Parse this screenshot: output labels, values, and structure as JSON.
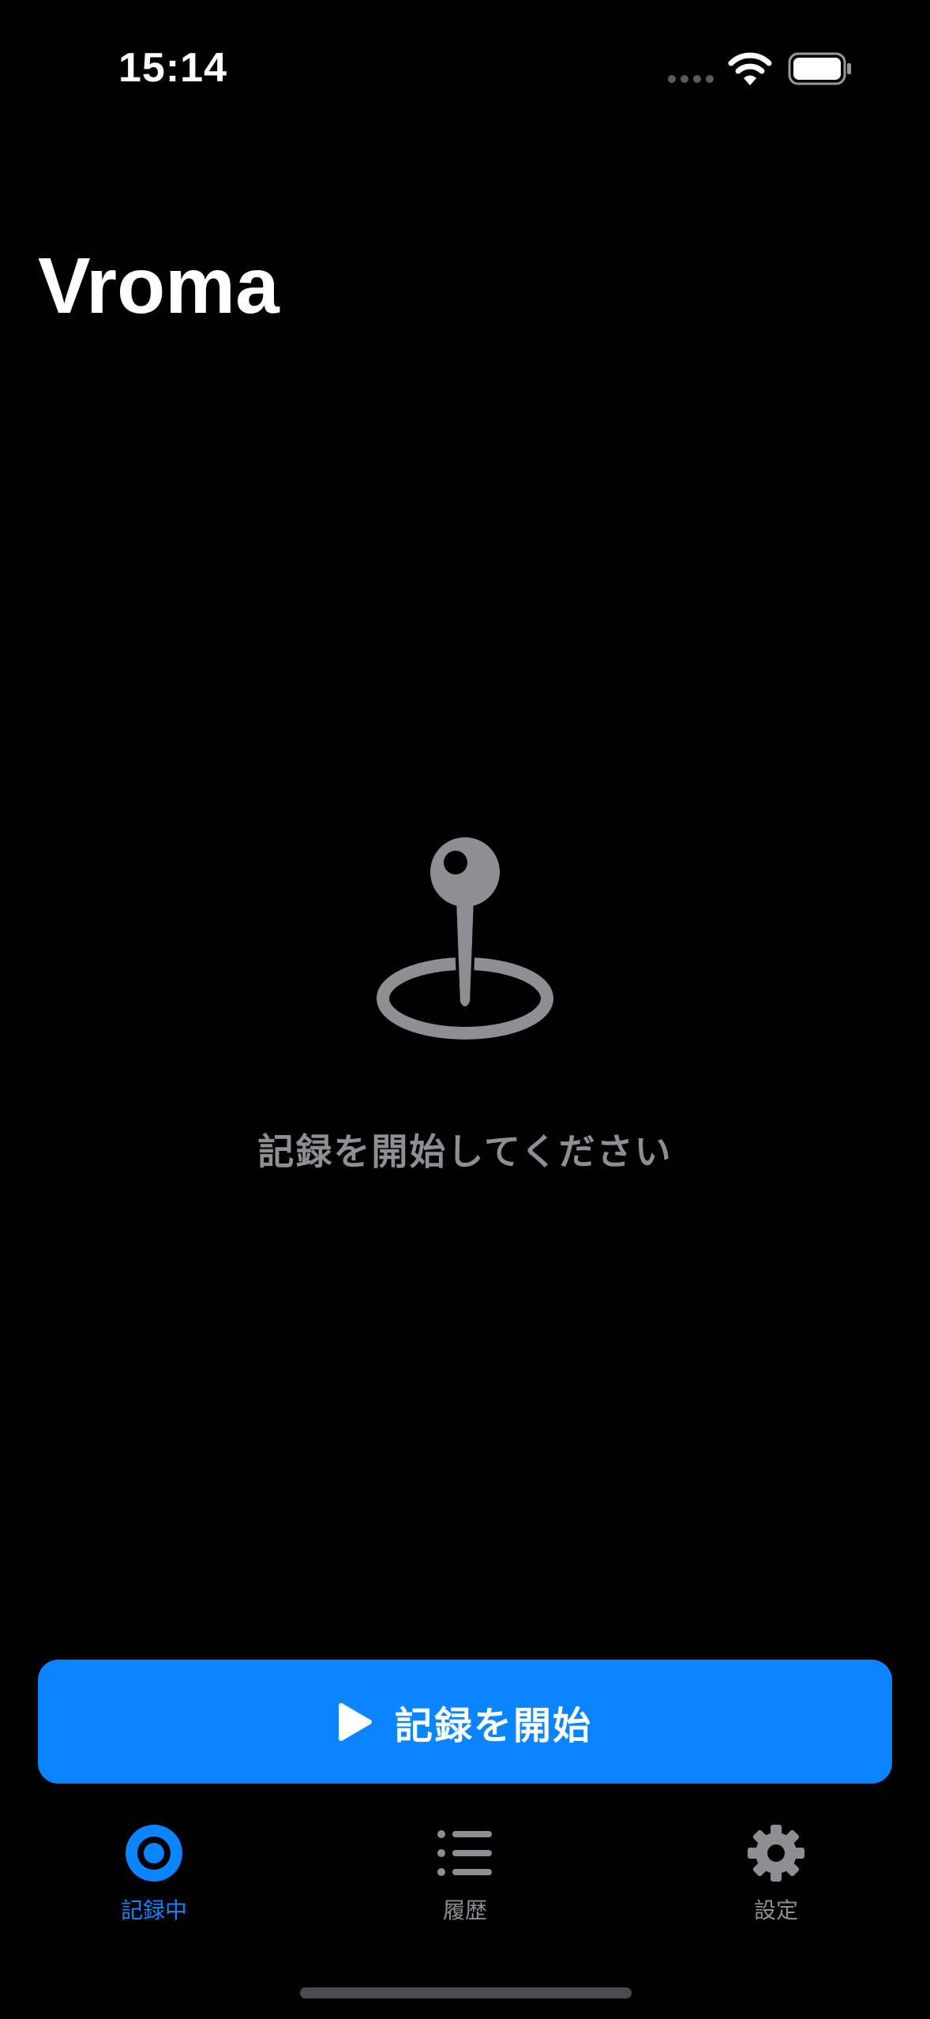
{
  "status_bar": {
    "time": "15:14",
    "battery": "full"
  },
  "app": {
    "title": "Vroma"
  },
  "empty_state": {
    "icon": "joystick-pin-icon",
    "message": "記録を開始してください"
  },
  "primary_action": {
    "label": "記録を開始",
    "icon": "play-icon",
    "color": "#0a84ff"
  },
  "tab_bar": {
    "items": [
      {
        "label": "記録中",
        "icon": "record-circle-icon",
        "active": true
      },
      {
        "label": "履歴",
        "icon": "list-icon",
        "active": false
      },
      {
        "label": "設定",
        "icon": "gear-icon",
        "active": false
      }
    ],
    "active_color": "#0a84ff",
    "inactive_color": "#8e8e93"
  }
}
